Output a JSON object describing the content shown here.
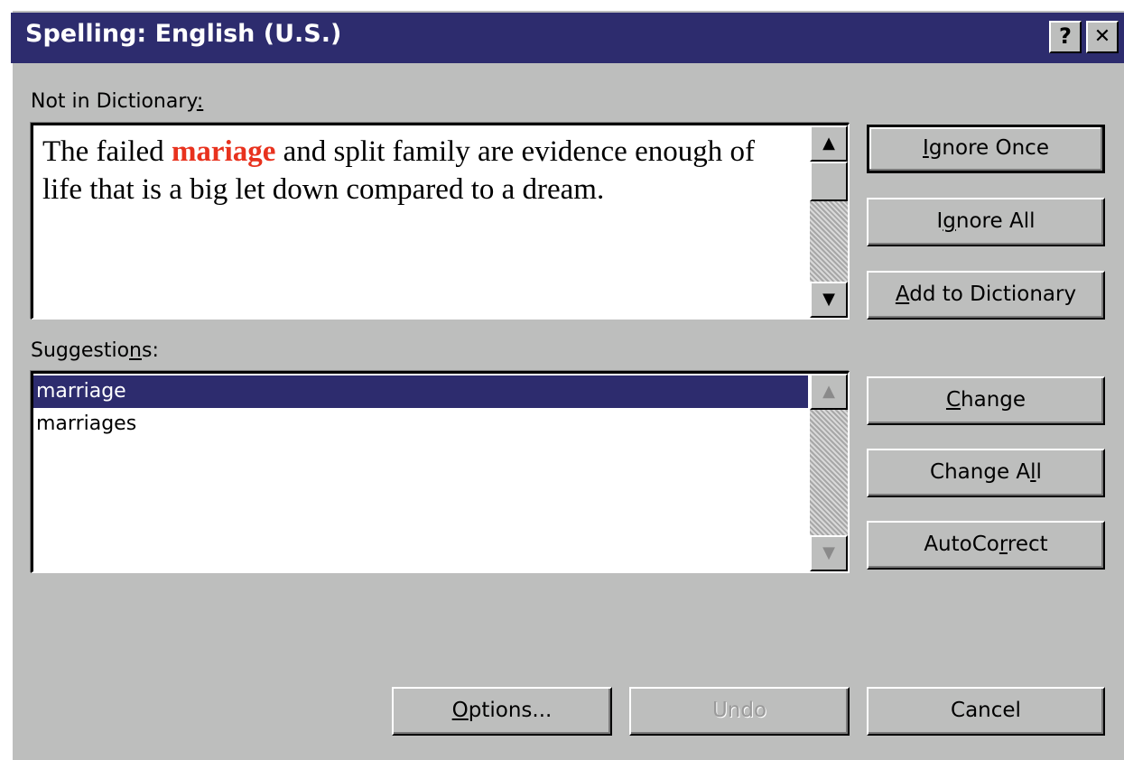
{
  "window": {
    "title": "Spelling: English (U.S.)",
    "help_button": "?",
    "close_button": "✕"
  },
  "not_in_dictionary": {
    "label": "Not in Dictionary:",
    "text_before": "The failed ",
    "misspelled_word": "mariage",
    "text_after": " and split family are evidence enough of life that is a big let down compared to a dream.",
    "highlight_color": "#e8321e"
  },
  "suggestions": {
    "label": "Suggestions:",
    "items": [
      {
        "label": "marriage",
        "selected": true
      },
      {
        "label": "marriages",
        "selected": false
      }
    ]
  },
  "buttons": {
    "ignore_once": "Ignore Once",
    "ignore_all": "Ignore All",
    "add_to_dictionary": "Add to Dictionary",
    "change": "Change",
    "change_all": "Change All",
    "autocorrect": "AutoCorrect",
    "options": "Options...",
    "undo": "Undo",
    "cancel": "Cancel"
  },
  "scroll_icons": {
    "up": "up-arrow-icon",
    "down": "down-arrow-icon"
  },
  "colors": {
    "titlebar": "#2d2c6e",
    "dialog_face": "#bdbebd",
    "selection": "#2d2c6e"
  }
}
